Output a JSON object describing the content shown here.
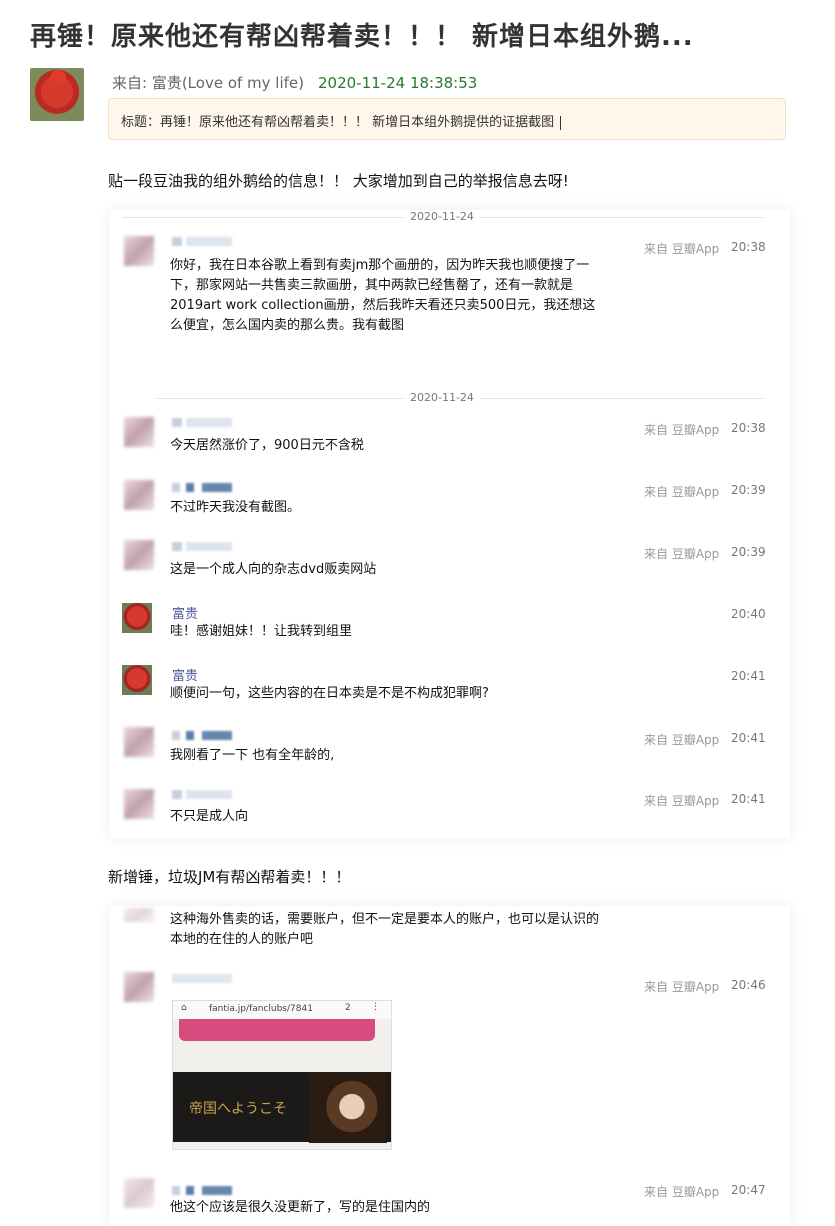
{
  "page": {
    "title": "再锤！原来他还有帮凶帮着卖！！！ 新增日本组外鹅...",
    "meta_from": "来自: 富贵(Love of my life)",
    "meta_time": "2020-11-24 18:38:53",
    "subject": "标题：再锤！原来他还有帮凶帮着卖！！！ 新增日本组外鹅提供的证据截图",
    "para1": "贴一段豆油我的组外鹅给的信息！！ 大家增加到自己的举报信息去呀!",
    "para2": "新增锤，垃圾JM有帮凶帮着卖！！！"
  },
  "chat1": {
    "date_top": "2020-11-24",
    "date_mid": "2020-11-24",
    "messages": [
      {
        "name": "",
        "text": "你好，我在日本谷歌上看到有卖jm那个画册的，因为昨天我也顺便搜了一下，那家网站一共售卖三款画册，其中两款已经售罄了，还有一款就是2019art work collection画册，然后我昨天看还只卖500日元，我还想这么便宜，怎么国内卖的那么贵。我有截图",
        "src": "来自 豆瓣App",
        "time": "20:38"
      },
      {
        "name": "",
        "text": "今天居然涨价了，900日元不含税",
        "src": "来自 豆瓣App",
        "time": "20:38"
      },
      {
        "name": "",
        "text": "不过昨天我没有截图。",
        "src": "来自 豆瓣App",
        "time": "20:39"
      },
      {
        "name": "",
        "text": "这是一个成人向的杂志dvd贩卖网站",
        "src": "来自 豆瓣App",
        "time": "20:39"
      },
      {
        "name": "富贵",
        "text": "哇！感谢姐妹！！让我转到组里",
        "src": "",
        "time": "20:40"
      },
      {
        "name": "富贵",
        "text": "顺便问一句，这些内容的在日本卖是不是不构成犯罪啊?",
        "src": "",
        "time": "20:41"
      },
      {
        "name": "",
        "text": "我刚看了一下 也有全年龄的,",
        "src": "来自 豆瓣App",
        "time": "20:41"
      },
      {
        "name": "",
        "text": "不只是成人向",
        "src": "来自 豆瓣App",
        "time": "20:41"
      }
    ]
  },
  "chat2": {
    "messages": [
      {
        "text": "这种海外售卖的话，需要账户，但不一定是要本人的账户，也可以是认识的本地的在住的人的账户吧"
      },
      {
        "text": "",
        "src": "来自 豆瓣App",
        "time": "20:46"
      },
      {
        "text": "他这个应该是很久没更新了，写的是住国内的",
        "src": "来自 豆瓣App",
        "time": "20:47"
      }
    ],
    "screenshot": {
      "url_text": "fantia.jp/fanclubs/7841",
      "banner_text": "帝国へようこそ"
    }
  }
}
